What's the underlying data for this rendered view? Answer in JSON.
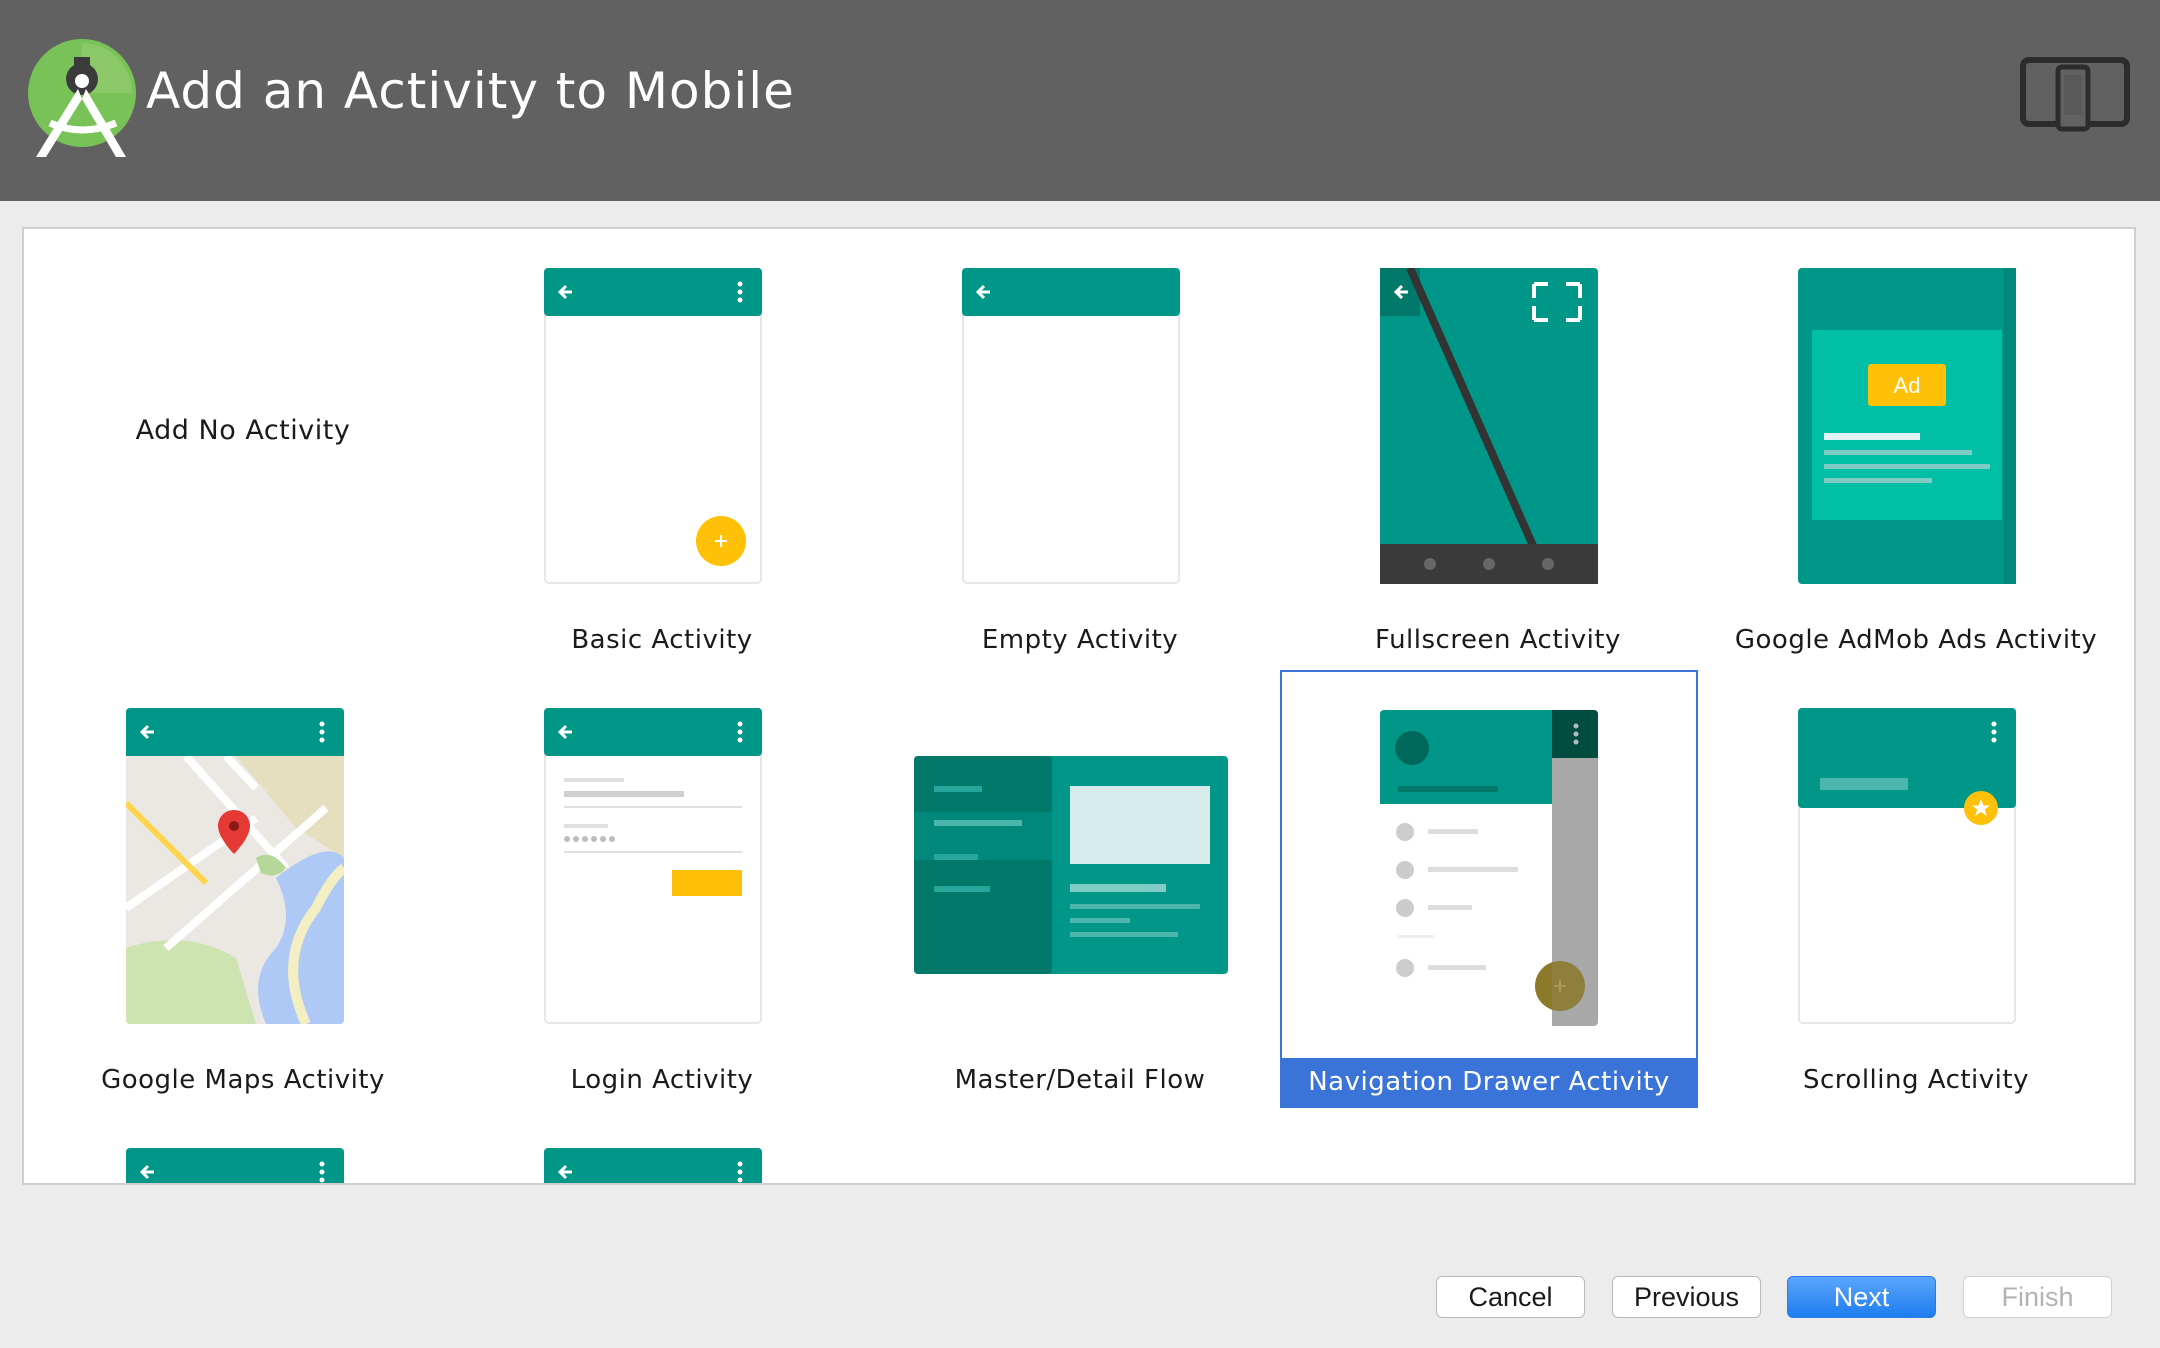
{
  "header": {
    "title": "Add an Activity to Mobile",
    "logo_icon": "android-studio-logo-icon",
    "device_icon": "tablet-phone-icon",
    "background": "#616161"
  },
  "gallery": {
    "teal": "#009688",
    "dark_teal": "#00796b",
    "accent_yellow": "#ffc107",
    "selected_color": "#3a74d9",
    "selected_item": "Navigation Drawer Activity",
    "items": [
      {
        "label": "Add No Activity"
      },
      {
        "label": "Basic Activity"
      },
      {
        "label": "Empty Activity"
      },
      {
        "label": "Fullscreen Activity"
      },
      {
        "label": "Google AdMob Ads Activity",
        "ad_badge": "Ad"
      },
      {
        "label": "Google Maps Activity"
      },
      {
        "label": "Login Activity"
      },
      {
        "label": "Master/Detail Flow"
      },
      {
        "label": "Navigation Drawer Activity"
      },
      {
        "label": "Scrolling Activity"
      }
    ]
  },
  "buttons": {
    "cancel": "Cancel",
    "previous": "Previous",
    "next": "Next",
    "finish": "Finish"
  }
}
